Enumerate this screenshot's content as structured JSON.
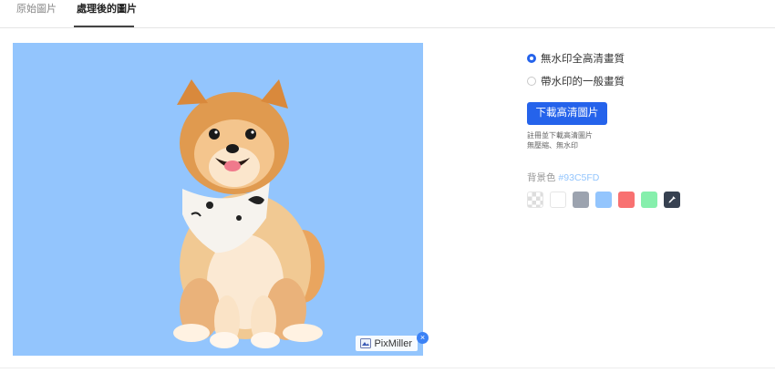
{
  "tabs": [
    {
      "label": "原始圖片",
      "active": false
    },
    {
      "label": "處理後的圖片",
      "active": true
    }
  ],
  "preview": {
    "background": "#93C5FD",
    "watermark": {
      "text": "PixMiller",
      "close_glyph": "×"
    }
  },
  "quality": {
    "options": [
      {
        "label": "無水印全高清畫質",
        "selected": true
      },
      {
        "label": "帶水印的一般畫質",
        "selected": false
      }
    ]
  },
  "download": {
    "label": "下載高清圖片",
    "note_line1": "註冊並下載高清圖片",
    "note_line2": "無壓縮、無水印"
  },
  "background": {
    "label": "背景色",
    "value": "#93C5FD",
    "swatches": [
      {
        "name": "transparent",
        "color": "transparent"
      },
      {
        "name": "white",
        "color": "#FFFFFF"
      },
      {
        "name": "gray",
        "color": "#9CA3AF"
      },
      {
        "name": "blue",
        "color": "#93C5FD"
      },
      {
        "name": "red",
        "color": "#F87171"
      },
      {
        "name": "green",
        "color": "#86EFAC"
      },
      {
        "name": "custom-picker",
        "color": "#374151",
        "icon": "eyedropper-icon"
      }
    ]
  },
  "colors": {
    "accent": "#2563EB"
  }
}
